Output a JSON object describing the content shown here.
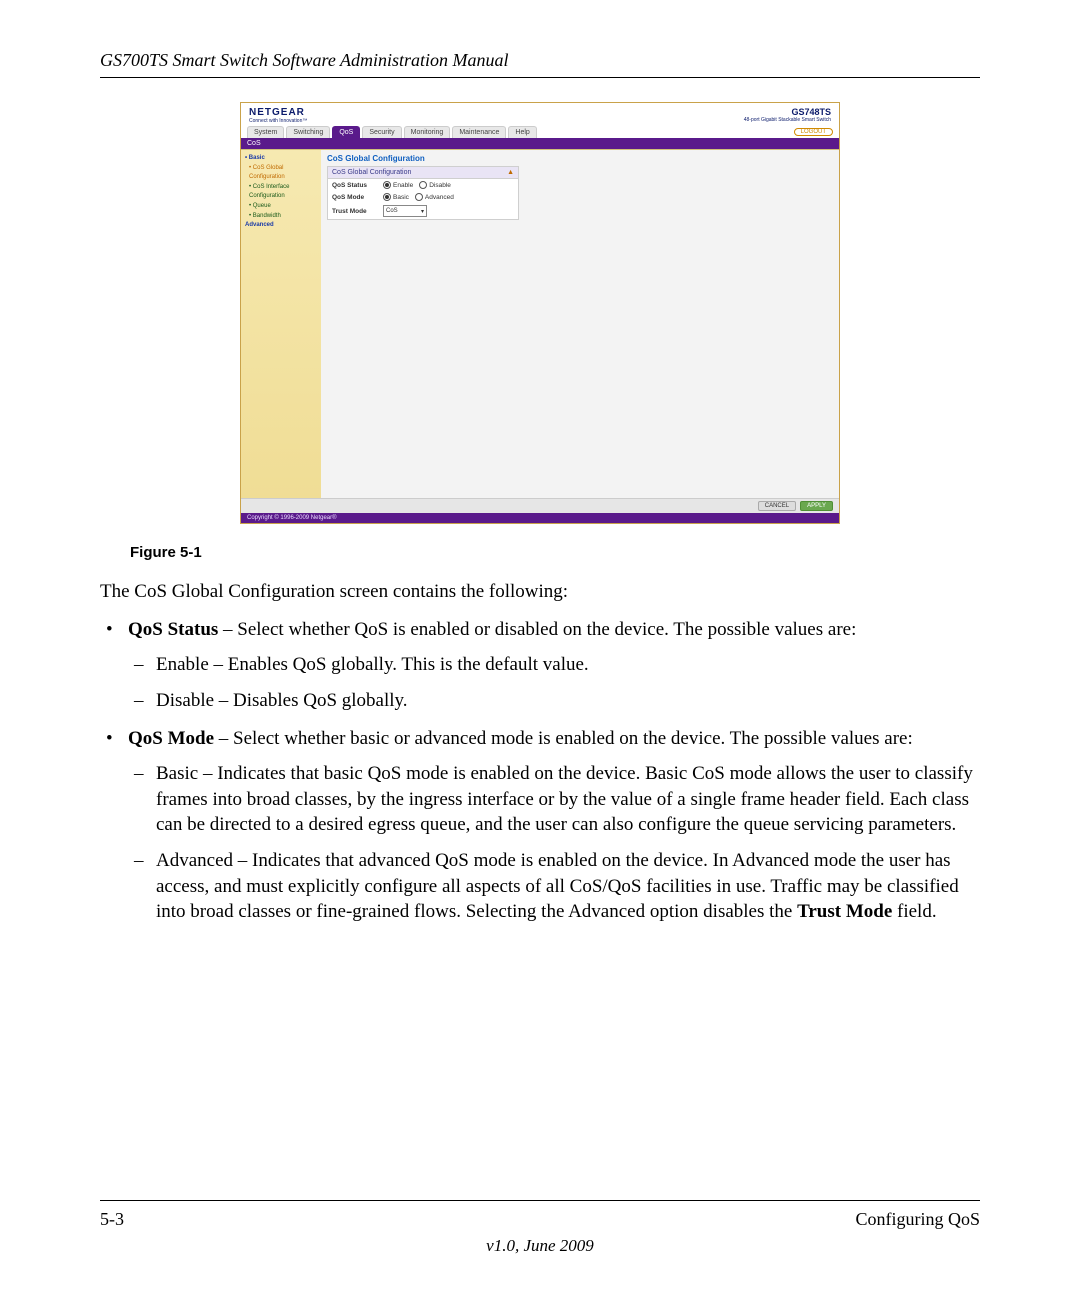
{
  "header": {
    "title": "GS700TS Smart Switch Software Administration Manual"
  },
  "screenshot": {
    "brand": "NETGEAR",
    "tagline": "Connect with Innovation™",
    "model_number": "GS748TS",
    "model_desc": "48-port Gigabit Stackable Smart Switch",
    "tabs": [
      "System",
      "Switching",
      "QoS",
      "Security",
      "Monitoring",
      "Maintenance",
      "Help"
    ],
    "active_tab": "QoS",
    "logout": "LOGOUT",
    "submenu": "CoS",
    "sidebar": {
      "group": "• Basic",
      "items": [
        "• CoS Global Configuration",
        "• CoS Interface Configuration",
        "• Queue",
        "• Bandwidth"
      ],
      "group2": "Advanced"
    },
    "panel": {
      "main_title": "CoS Global Configuration",
      "box_title": "CoS Global Configuration",
      "rows": {
        "qos_status": {
          "label": "QoS Status",
          "opt1": "Enable",
          "opt2": "Disable"
        },
        "qos_mode": {
          "label": "QoS Mode",
          "opt1": "Basic",
          "opt2": "Advanced"
        },
        "trust_mode": {
          "label": "Trust Mode",
          "value": "CoS"
        }
      }
    },
    "buttons": {
      "cancel": "CANCEL",
      "apply": "APPLY"
    },
    "copyright": "Copyright © 1996-2009 Netgear®"
  },
  "caption": "Figure 5-1",
  "intro": "The CoS Global Configuration screen contains the following:",
  "bullets": {
    "b1": {
      "lead": "QoS Status",
      "text": " – Select whether QoS is enabled or disabled on the device. The possible values are:",
      "sub1": "Enable – Enables QoS globally. This is the default value.",
      "sub2": "Disable – Disables QoS globally."
    },
    "b2": {
      "lead": "QoS Mode",
      "text": " – Select whether basic or advanced mode is enabled on the device. The possible values are:",
      "sub1": "Basic – Indicates that basic QoS mode is enabled on the device. Basic CoS mode allows the user to classify frames into broad classes, by the ingress interface or by the value of a single frame header field. Each class can be directed to a desired egress queue, and the user can also configure the queue servicing parameters.",
      "sub2a": "Advanced – Indicates that advanced QoS mode is enabled on the device. In Advanced mode the user has access, and must explicitly configure all aspects of all CoS/QoS facilities in use. Traffic may be classified into broad classes or fine-grained flows. Selecting the Advanced option disables the ",
      "sub2b": "Trust Mode",
      "sub2c": " field."
    }
  },
  "footer": {
    "left": "5-3",
    "right": "Configuring QoS",
    "version": "v1.0, June 2009"
  }
}
